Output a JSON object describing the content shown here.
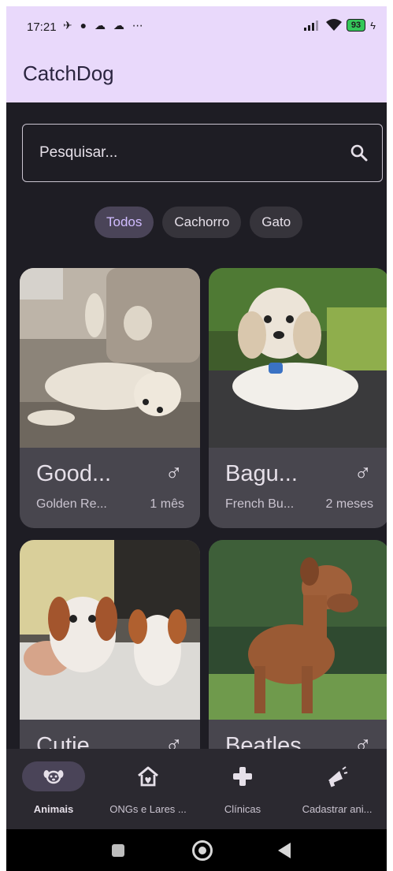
{
  "status_bar": {
    "time": "17:21",
    "notification_glyphs": "✈︎ ● ☁ ☁ ⋯",
    "battery": "93"
  },
  "app_bar": {
    "title": "CatchDog"
  },
  "search": {
    "placeholder": "Pesquisar..."
  },
  "filters": [
    {
      "label": "Todos",
      "selected": true
    },
    {
      "label": "Cachorro",
      "selected": false
    },
    {
      "label": "Gato",
      "selected": false
    }
  ],
  "animals": [
    {
      "name": "Good...",
      "sex": "♂",
      "breed": "Golden Re...",
      "age": "1 mês"
    },
    {
      "name": "Bagu...",
      "sex": "♂",
      "breed": "French Bu...",
      "age": "2 meses"
    },
    {
      "name": "Cutie",
      "sex": "♂",
      "breed": "",
      "age": ""
    },
    {
      "name": "Beatles",
      "sex": "♂",
      "breed": "",
      "age": ""
    }
  ],
  "bottom_nav": [
    {
      "label": "Animais",
      "icon": "dog-face-icon",
      "selected": true
    },
    {
      "label": "ONGs e Lares ...",
      "icon": "home-icon",
      "selected": false
    },
    {
      "label": "Clínicas",
      "icon": "medical-cross-icon",
      "selected": false
    },
    {
      "label": "Cadastrar ani...",
      "icon": "megaphone-icon",
      "selected": false
    }
  ],
  "colors": {
    "app_bar_bg": "#e9d9fb",
    "surface": "#1e1d24",
    "card": "#48464e",
    "chip_selected": "#4a4458",
    "accent_text": "#d0bcff"
  }
}
